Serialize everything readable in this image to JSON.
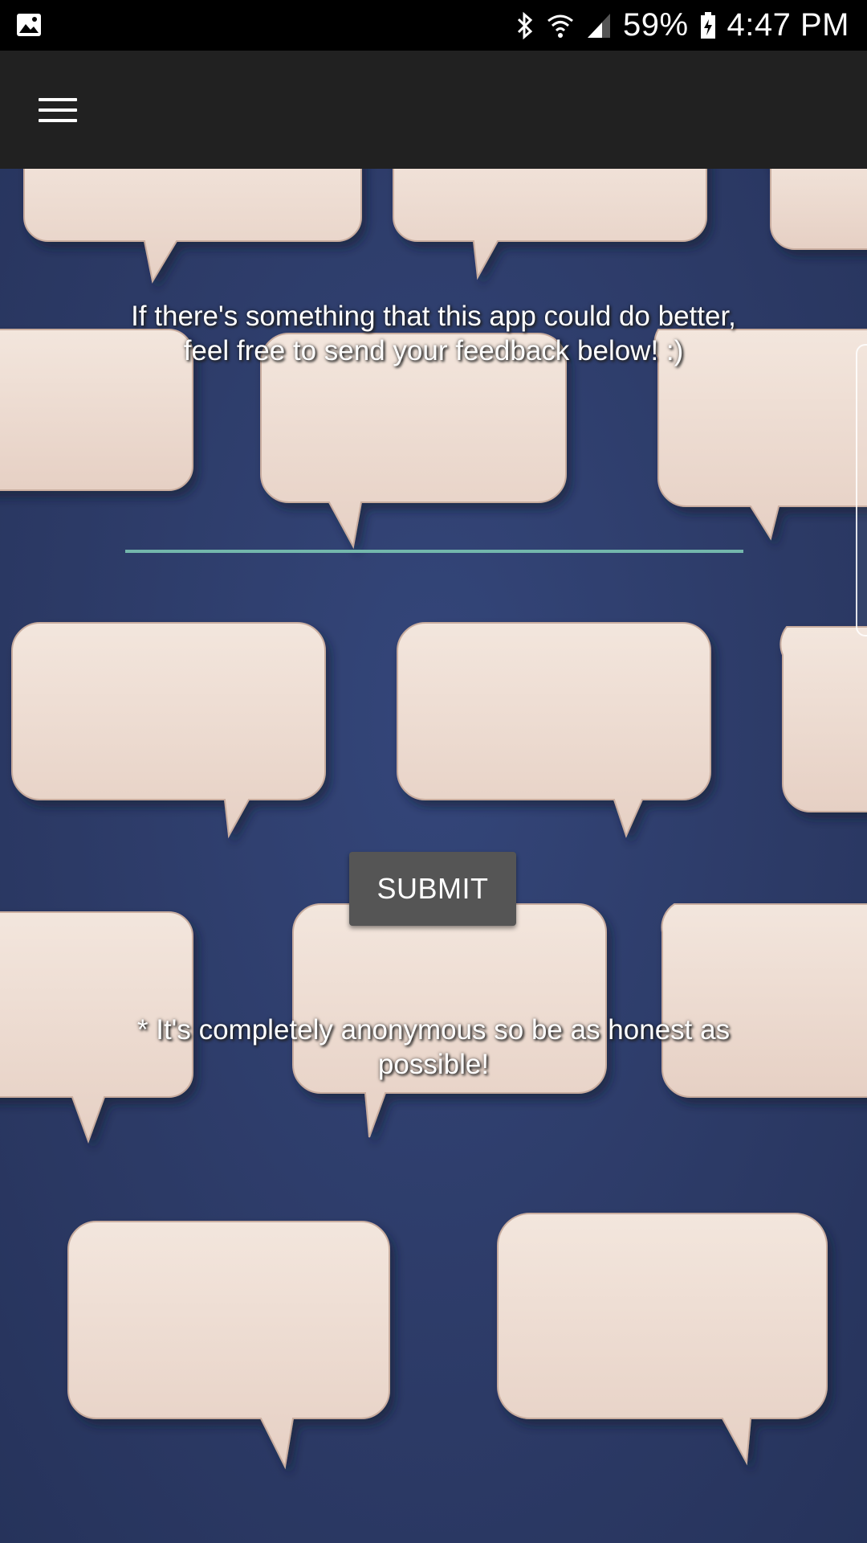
{
  "status_bar": {
    "battery": "59%",
    "time": "4:47 PM",
    "left_icon": "image-icon",
    "right_icons": [
      "bluetooth-icon",
      "wifi-icon",
      "signal-icon",
      "battery-icon"
    ]
  },
  "app_bar": {
    "menu_icon": "hamburger-menu-icon"
  },
  "feedback": {
    "intro": "If there's something that this app could do better, feel free to send your feedback below! :)",
    "input_value": "",
    "input_underline_color": "#73b7ac",
    "submit_label": "SUBMIT",
    "note": "* It's completely anonymous so be as honest as possible!"
  }
}
